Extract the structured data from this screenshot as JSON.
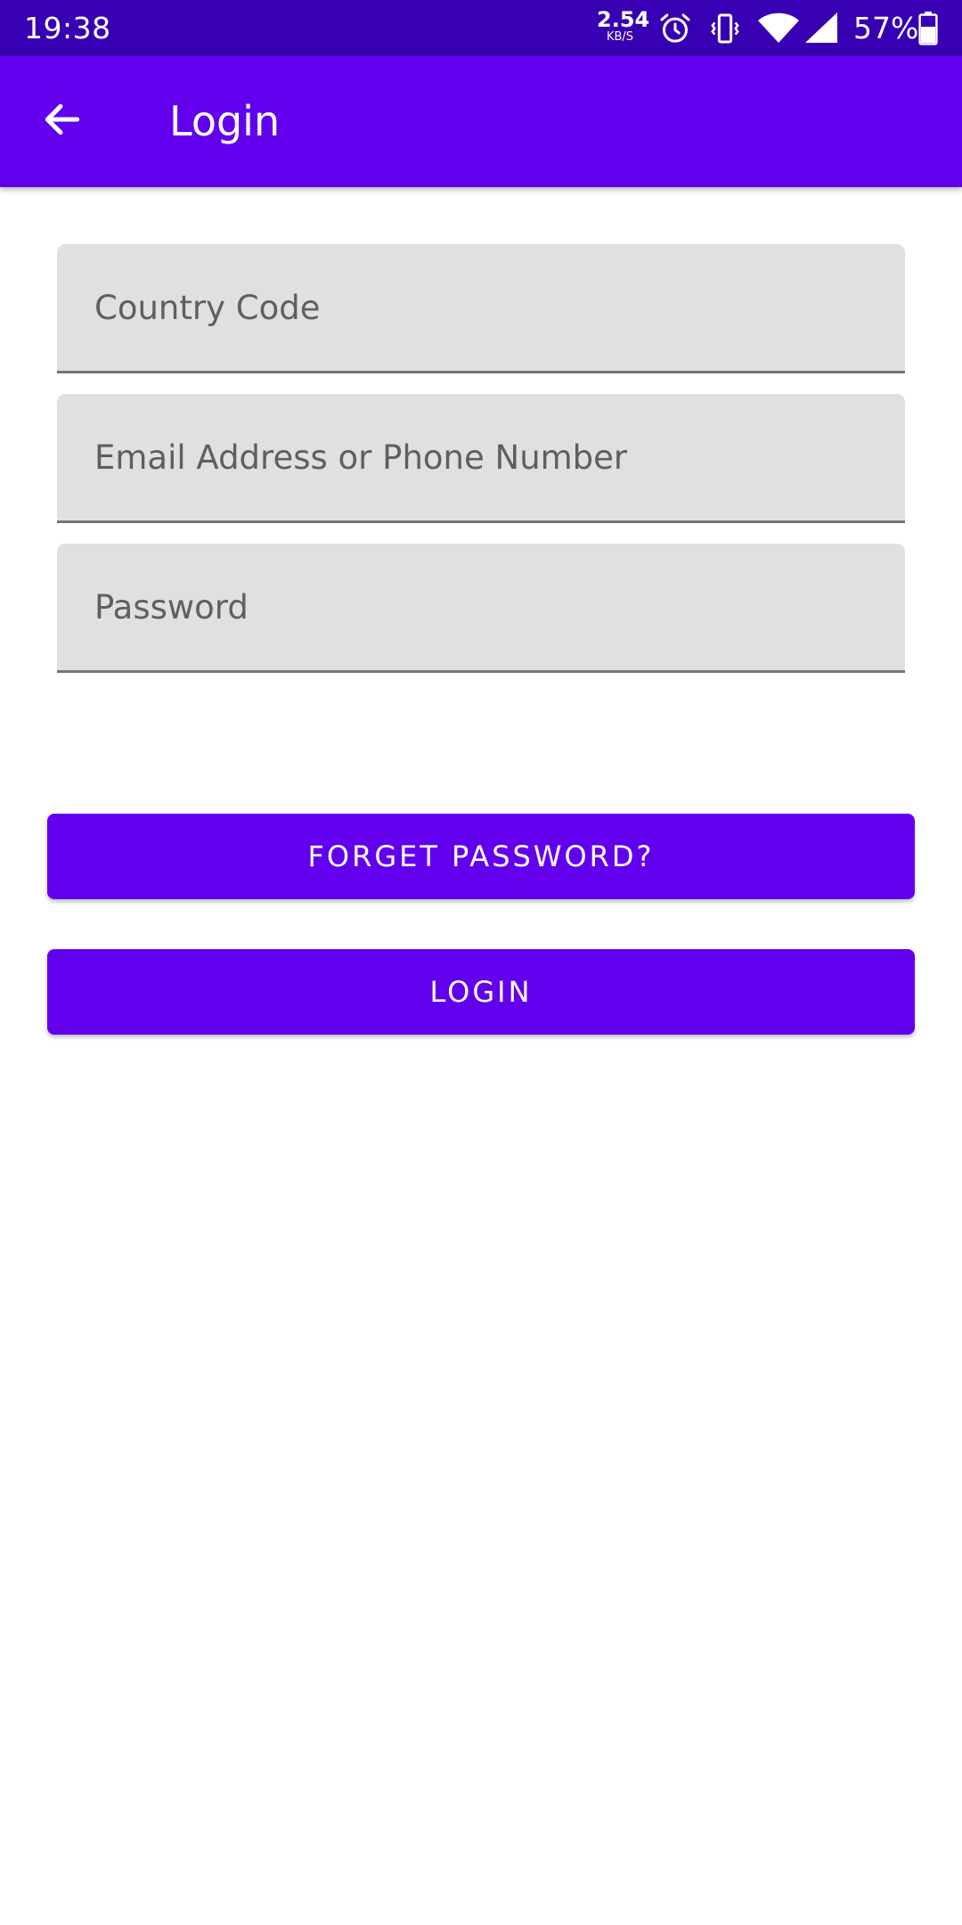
{
  "status_bar": {
    "time": "19:38",
    "net_speed_value": "2.54",
    "net_speed_unit": "KB/S",
    "battery_percent": "57%",
    "icons": [
      "alarm-icon",
      "vibrate-icon",
      "wifi-icon",
      "signal-icon",
      "battery-icon"
    ]
  },
  "app_bar": {
    "title": "Login",
    "back_icon": "arrow-back-icon"
  },
  "form": {
    "country_code_placeholder": "Country Code",
    "email_placeholder": "Email Address or Phone Number",
    "password_placeholder": "Password",
    "country_code_value": "",
    "email_value": "",
    "password_value": ""
  },
  "buttons": {
    "forget_password": "FORGET PASSWORD?",
    "login": "LOGIN"
  },
  "colors": {
    "primary": "#6200ee",
    "primary_dark": "#3700b3",
    "field_background": "#e0e0e0"
  }
}
